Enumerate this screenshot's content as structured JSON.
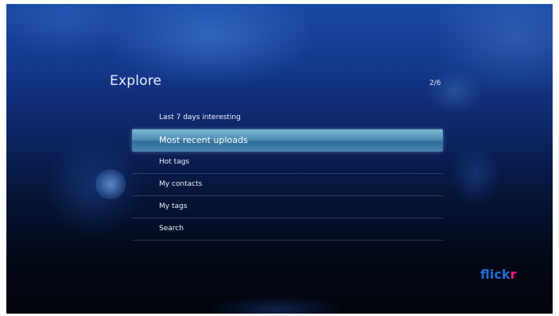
{
  "header": {
    "title": "Explore",
    "page_indicator": "2/6"
  },
  "menu": {
    "items": [
      {
        "label": "Last 7 days interesting",
        "selected": false
      },
      {
        "label": "Most recent uploads",
        "selected": true
      },
      {
        "label": "Hot tags",
        "selected": false
      },
      {
        "label": "My contacts",
        "selected": false
      },
      {
        "label": "My tags",
        "selected": false
      },
      {
        "label": "Search",
        "selected": false
      }
    ]
  },
  "logo": {
    "text_main": "flick",
    "text_accent": "r",
    "colors": {
      "main": "#1f6fd0",
      "accent": "#ff1a8c"
    }
  },
  "colors": {
    "background_top": "#1a4aa6",
    "background_bottom": "#01040c",
    "selection_highlight": "#4f8fb4"
  }
}
